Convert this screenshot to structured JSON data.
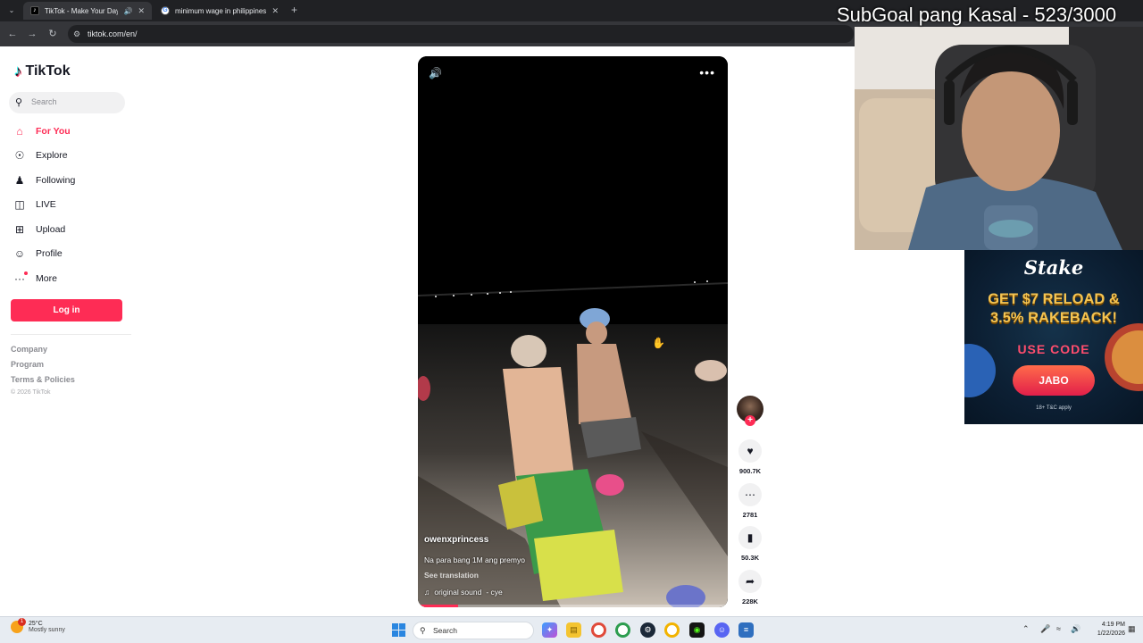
{
  "browser": {
    "tabs": [
      {
        "title": "TikTok - Make Your Day",
        "icon": "tiktok-favicon",
        "active": true
      },
      {
        "title": "minimum wage in philippines",
        "icon": "google-favicon",
        "active": false
      }
    ],
    "url": "tiktok.com/en/"
  },
  "overlay": {
    "subgoal": "SubGoal pang Kasal - 523/3000"
  },
  "tiktok": {
    "logo": "TikTok",
    "search_placeholder": "Search",
    "nav": [
      {
        "label": "For You",
        "icon": "home-icon",
        "active": true
      },
      {
        "label": "Explore",
        "icon": "compass-icon"
      },
      {
        "label": "Following",
        "icon": "following-icon"
      },
      {
        "label": "LIVE",
        "icon": "live-icon"
      },
      {
        "label": "Upload",
        "icon": "upload-icon"
      },
      {
        "label": "Profile",
        "icon": "profile-icon"
      },
      {
        "label": "More",
        "icon": "more-icon"
      }
    ],
    "login_label": "Log in",
    "footer": [
      "Company",
      "Program",
      "Terms & Policies"
    ],
    "copyright": "© 2026 TikTok",
    "video": {
      "author": "owenxprincess",
      "caption": "Na para bang 1M ang premyo",
      "see_translation": "See translation",
      "sound": "original sound",
      "sound_artist": "- cye",
      "progress": 0.13
    },
    "actions": {
      "likes": "900.7K",
      "comments": "2781",
      "saves": "50.3K",
      "shares": "228K"
    }
  },
  "ad": {
    "brand": "Stake",
    "headline_1": "GET $7 RELOAD &",
    "headline_2": "3.5% RAKEBACK!",
    "use_code": "USE CODE",
    "code": "JABO",
    "fine_print": "18+ T&C apply"
  },
  "taskbar": {
    "weather_temp": "25°C",
    "weather_desc": "Mostly sunny",
    "weather_badge": "1",
    "search_placeholder": "Search",
    "time": "4:19 PM",
    "date": "1/22/2026"
  }
}
